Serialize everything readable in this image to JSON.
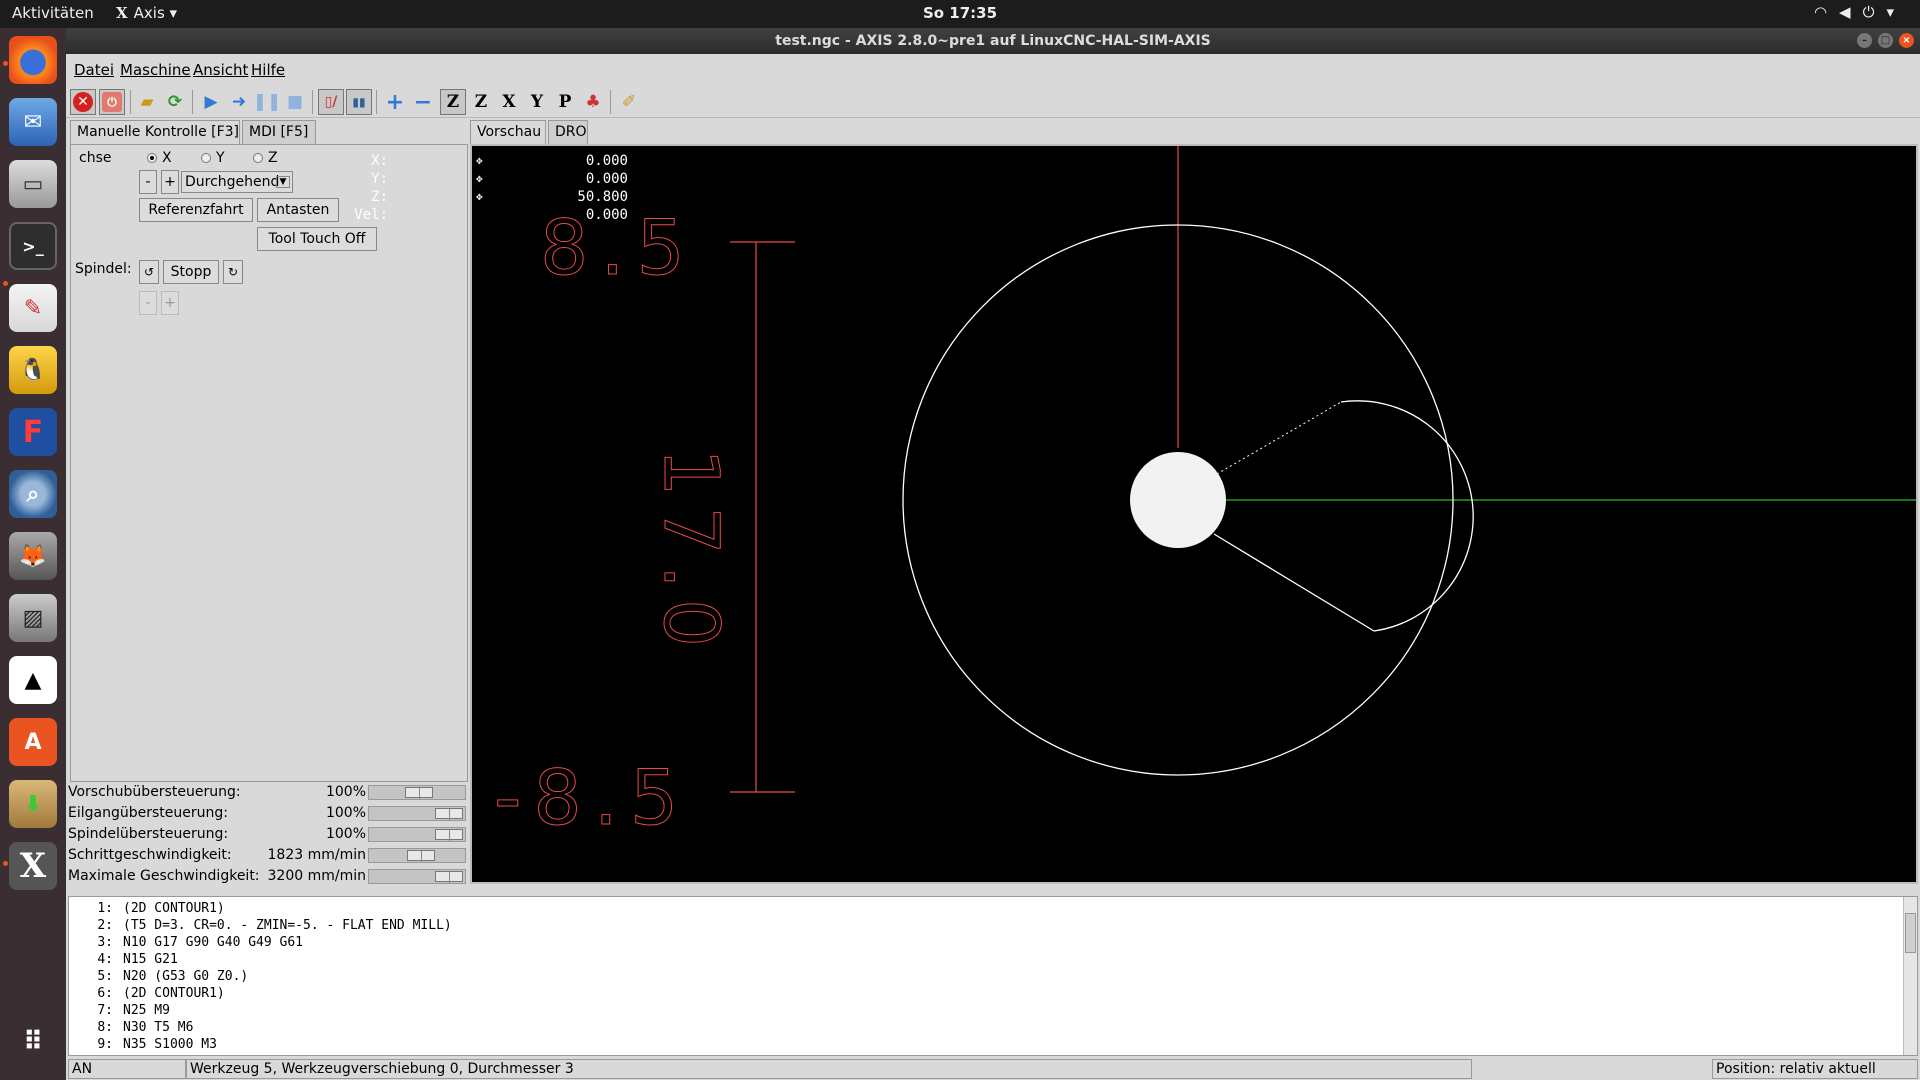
{
  "topbar": {
    "activities": "Aktivitäten",
    "app_name": "Axis",
    "clock": "So 17:35"
  },
  "window": {
    "title": "test.ngc - AXIS 2.8.0~pre1 auf  LinuxCNC-HAL-SIM-AXIS"
  },
  "menu": [
    "Datei",
    "Maschine",
    "Ansicht",
    "Hilfe"
  ],
  "toolbar": {
    "icons": [
      "estop-icon",
      "machine-power-icon",
      "open-file-icon",
      "reload-icon",
      "run-icon",
      "step-icon",
      "pause-icon",
      "stop-icon",
      "block-delete-icon",
      "optional-stop-icon",
      "zoom-in-icon",
      "zoom-out-icon",
      "view-z-icon",
      "view-z2-icon",
      "view-x-icon",
      "view-y-icon",
      "view-p-icon",
      "rotate-icon",
      "clear-live-plot-icon"
    ]
  },
  "left_tabs": [
    "Manuelle Kontrolle [F3]",
    "MDI [F5]"
  ],
  "manual": {
    "axis_label": "chse",
    "axes": [
      "X",
      "Y",
      "Z"
    ],
    "selected_axis": "X",
    "minus": "-",
    "plus": "+",
    "jog_mode": "Durchgehend",
    "home_button": "Referenzfahrt",
    "touch_button": "Antasten",
    "tool_touch_off": "Tool Touch Off",
    "spindle_label": "Spindel:",
    "spindle_stop": "Stopp",
    "spindle_minus": "-",
    "spindle_plus": "+"
  },
  "overrides": [
    {
      "name": "Vorschubübersteuerung:",
      "value": "100%",
      "fraction": 0.55
    },
    {
      "name": "Eilgangübersteuerung:",
      "value": "100%",
      "fraction": 1.0
    },
    {
      "name": "Spindelübersteuerung:",
      "value": "100%",
      "fraction": 1.0
    },
    {
      "name": "Schrittgeschwindigkeit:",
      "value": "1823 mm/min",
      "fraction": 0.57
    },
    {
      "name": "Maximale Geschwindigkeit:",
      "value": "3200 mm/min",
      "fraction": 1.0
    }
  ],
  "right_tabs": [
    "Vorschau",
    "DRO"
  ],
  "dro": [
    {
      "label": "X:",
      "value": "0.000"
    },
    {
      "label": "Y:",
      "value": "0.000"
    },
    {
      "label": "Z:",
      "value": "50.800"
    },
    {
      "label": "Vel:",
      "value": "0.000"
    }
  ],
  "preview": {
    "dim_top": "8.5",
    "dim_bottom": "-8.5",
    "dim_length": "17.0",
    "colors": {
      "dimension": "#e84a4a",
      "path": "#ffffff",
      "x_axis": "#1fa01f",
      "y_axis": "#e84a4a"
    }
  },
  "gcode": [
    "(2D CONTOUR1)",
    "(T5 D=3. CR=0. - ZMIN=-5. - FLAT END MILL)",
    "N10 G17 G90 G40 G49 G61",
    "N15 G21",
    "N20 (G53 G0 Z0.)",
    "(2D CONTOUR1)",
    "N25 M9",
    "N30 T5 M6",
    "N35 S1000 M3"
  ],
  "status": {
    "state": "AN",
    "tool": "Werkzeug 5, Werkzeugverschiebung 0, Durchmesser 3",
    "position": "Position: relativ aktuell"
  }
}
